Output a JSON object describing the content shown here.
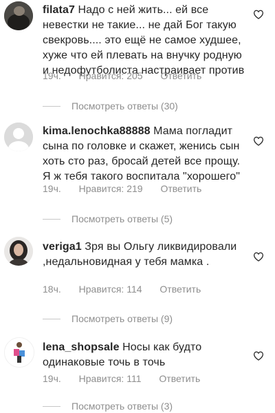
{
  "comments": [
    {
      "username": "filata7",
      "text": "Надо с ней жить... ей все невестки не такие... не дай Бог такую свекровь.... это ещё не самое худшее, хуже что ей плевать на внучку родную и недофутболиста настраивает против",
      "time": "19ч.",
      "likes": "Нравится: 205",
      "reply": "Ответить",
      "replies": "Посмотреть ответы (30)",
      "avatar": "dark-photo-avatar"
    },
    {
      "username": "kima.lenochka88888",
      "text": "Мама погладит сына по головке и скажет, женись сын хоть сто раз, бросай детей все прощу. Я ж тебя такого воспитала \"хорошего\"",
      "time": "19ч.",
      "likes": "Нравится: 219",
      "reply": "Ответить",
      "replies": "Посмотреть ответы (5)",
      "avatar": "default-user-avatar"
    },
    {
      "username": "veriga1",
      "text": "Зря вы Ольгу ликвидировали ,недальновидная у тебя мамка .",
      "time": "18ч.",
      "likes": "Нравится: 114",
      "reply": "Ответить",
      "replies": "Посмотреть ответы (9)",
      "avatar": "woman-photo-avatar"
    },
    {
      "username": "lena_shopsale",
      "text": "Носы как будто одинаковые точь в точь",
      "time": "19ч.",
      "likes": "Нравится: 111",
      "reply": "Ответить",
      "replies": "Посмотреть ответы (3)",
      "avatar": "shopping-avatar"
    }
  ]
}
